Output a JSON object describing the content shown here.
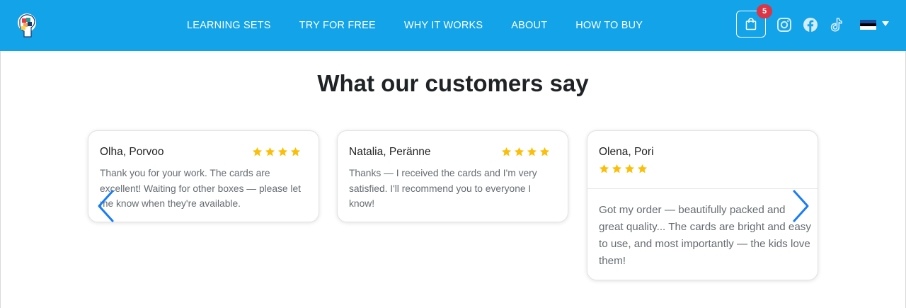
{
  "header": {
    "nav": [
      "LEARNING SETS",
      "TRY FOR FREE",
      "WHY IT WORKS",
      "ABOUT",
      "HOW TO BUY"
    ],
    "cart_count": "5",
    "icons": [
      "logo",
      "shopping-bag-icon",
      "instagram-icon",
      "facebook-icon",
      "tiktok-icon",
      "estonia-flag-icon",
      "caret-down-icon"
    ],
    "background_color": "#12a3e8"
  },
  "section": {
    "title": "What our customers say"
  },
  "reviews": [
    {
      "name": "Olha, Porvoo",
      "rating": 4,
      "text": "Thank you for your work. The cards are excellent! Waiting for other boxes — please let me know when they're available."
    },
    {
      "name": "Natalia, Peränne",
      "rating": 4,
      "text": "Thanks — I received the cards and I'm very satisfied. I'll recommend you to everyone I know!"
    },
    {
      "name": "Olena, Pori",
      "rating": 4,
      "text": "Got my order — beautifully packed and great quality... The cards are bright and easy to use, and most importantly — the kids love them!"
    }
  ],
  "carousel": {
    "prev_icon": "chevron-left-icon",
    "next_icon": "chevron-right-icon"
  },
  "colors": {
    "star": "#fbbf0a",
    "arrow": "#1a7cf5",
    "badge": "#dc3545"
  }
}
